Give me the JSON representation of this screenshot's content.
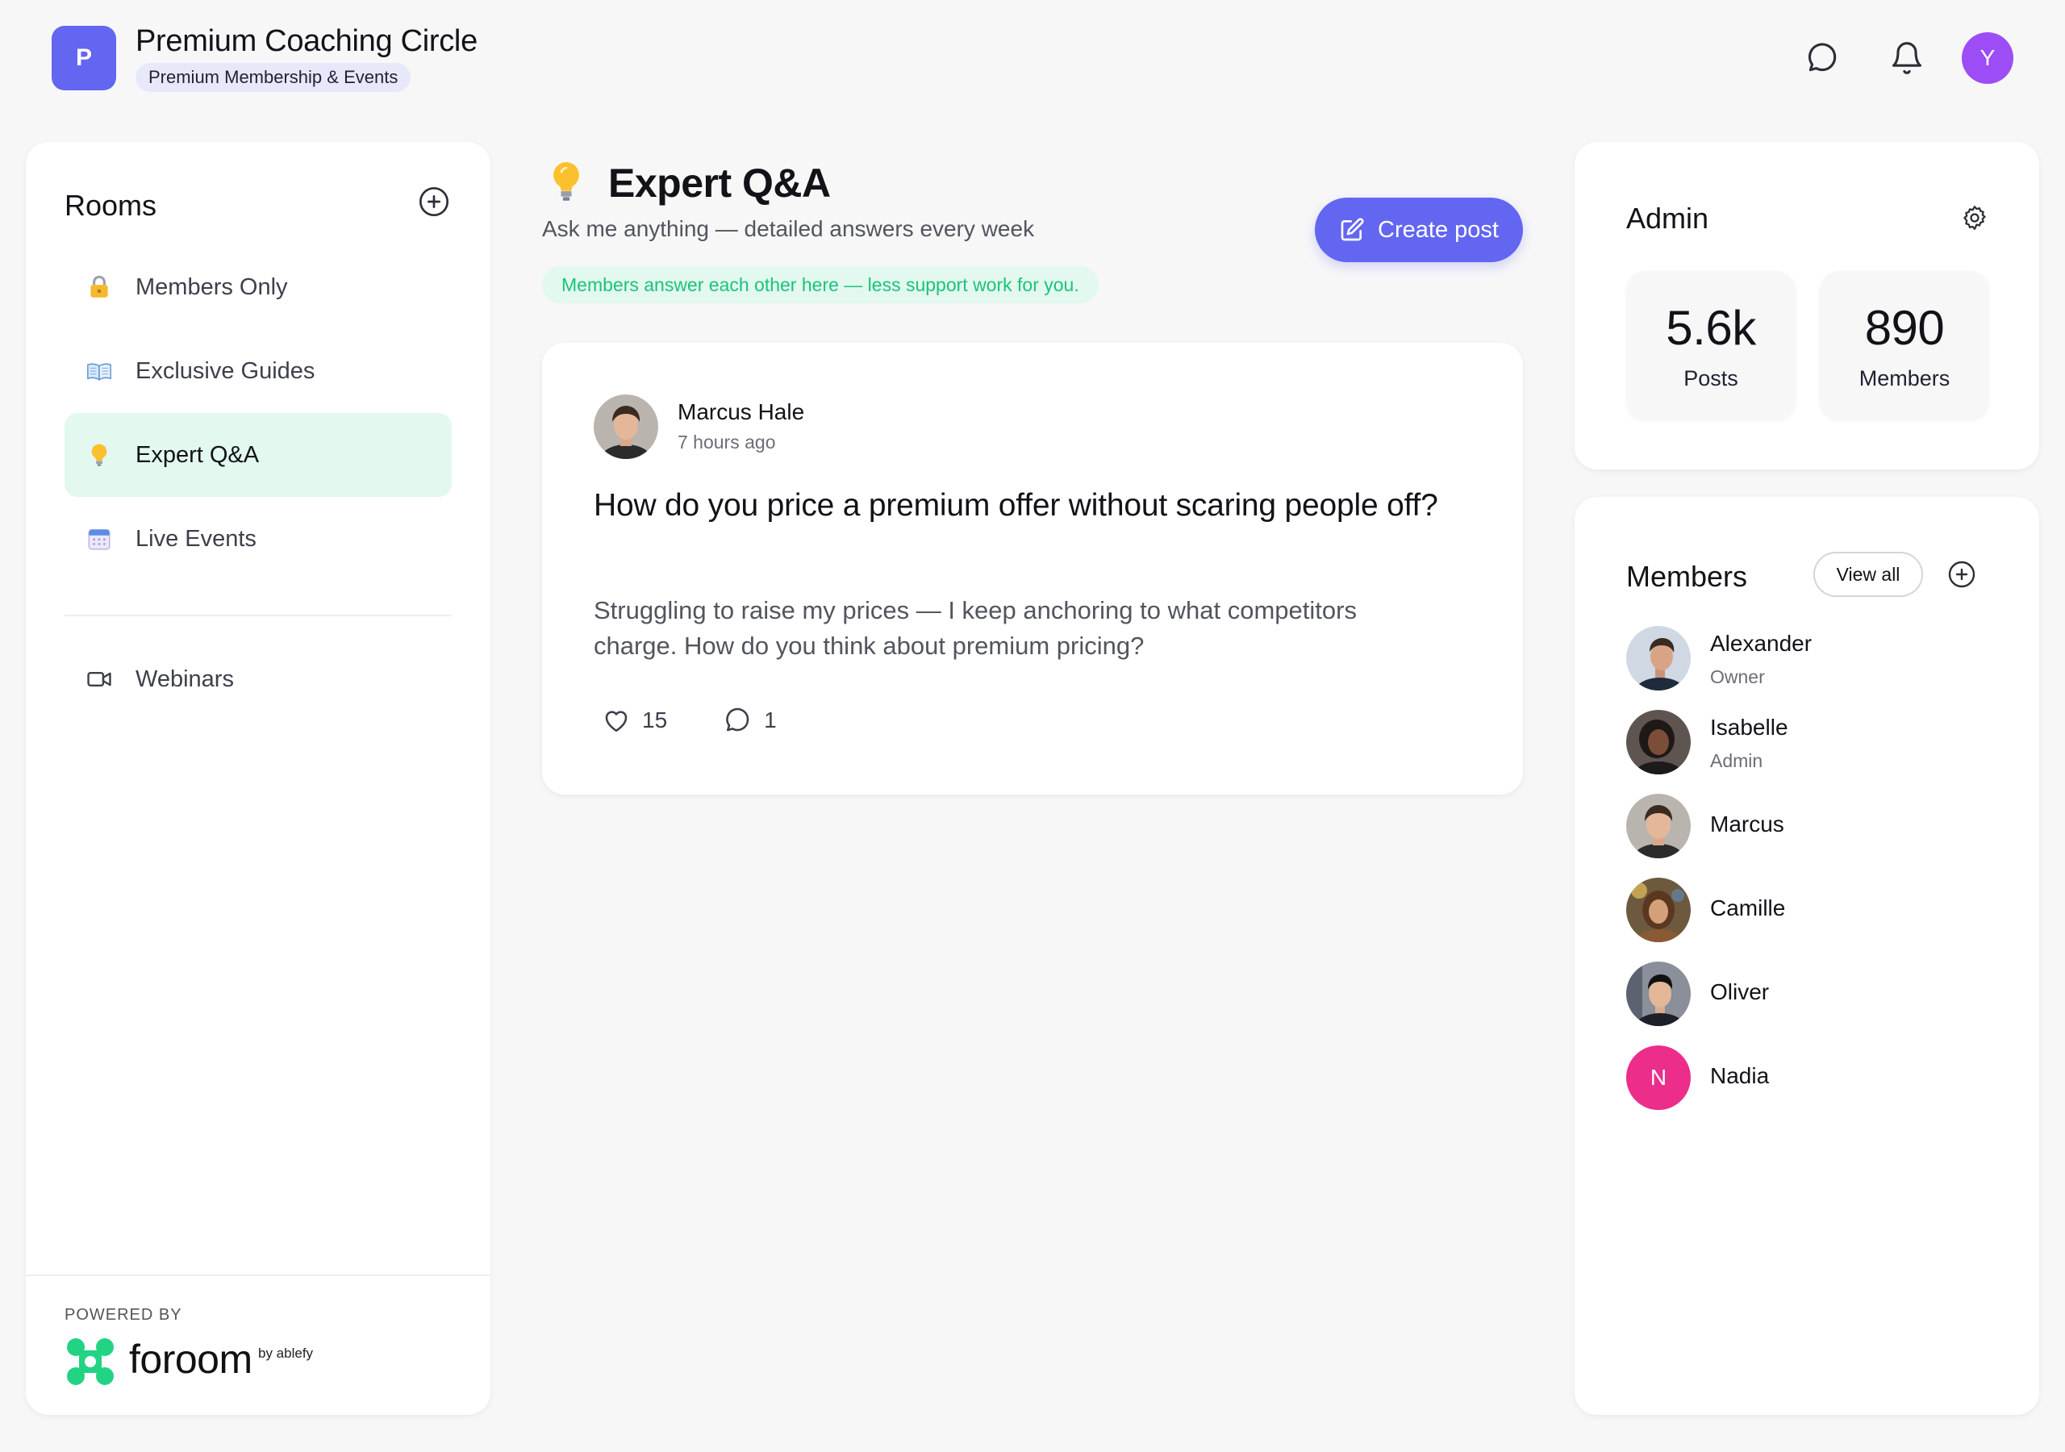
{
  "header": {
    "logo_letter": "P",
    "title": "Premium Coaching Circle",
    "subtitle": "Premium Membership & Events",
    "user_initial": "Y"
  },
  "sidebar": {
    "title": "Rooms",
    "items": [
      {
        "label": "Members Only",
        "icon": "lock-icon"
      },
      {
        "label": "Exclusive Guides",
        "icon": "book-icon"
      },
      {
        "label": "Expert Q&A",
        "icon": "lightbulb-icon",
        "active": true
      },
      {
        "label": "Live Events",
        "icon": "calendar-icon"
      },
      {
        "label": "Webinars",
        "icon": "video-camera-icon"
      }
    ],
    "powered_by": "POWERED BY",
    "brand": "foroom",
    "brand_by": "by ablefy"
  },
  "main": {
    "title": "Expert Q&A",
    "subtitle": "Ask me anything — detailed answers every week",
    "tip": "Members answer each other here — less support work for you.",
    "create_label": "Create post",
    "post": {
      "author": "Marcus Hale",
      "time": "7 hours ago",
      "title": "How do you price a premium offer without scaring people off?",
      "body": "Struggling to raise my prices — I keep anchoring to what competitors charge. How do you think about premium pricing?",
      "likes": "15",
      "comments": "1"
    }
  },
  "admin": {
    "title": "Admin",
    "stats": [
      {
        "value": "5.6k",
        "label": "Posts"
      },
      {
        "value": "890",
        "label": "Members"
      }
    ]
  },
  "members": {
    "title": "Members",
    "view_all": "View all",
    "list": [
      {
        "name": "Alexander",
        "role": "Owner"
      },
      {
        "name": "Isabelle",
        "role": "Admin"
      },
      {
        "name": "Marcus",
        "role": ""
      },
      {
        "name": "Camille",
        "role": ""
      },
      {
        "name": "Oliver",
        "role": ""
      },
      {
        "name": "Nadia",
        "role": "",
        "initial": "N"
      }
    ]
  },
  "colors": {
    "accent": "#6366f1",
    "active_room_bg": "#e3f8ef",
    "tip_text": "#19c47a",
    "avatar_user": "#9d4df5",
    "avatar_nadia": "#ec2d8a"
  }
}
